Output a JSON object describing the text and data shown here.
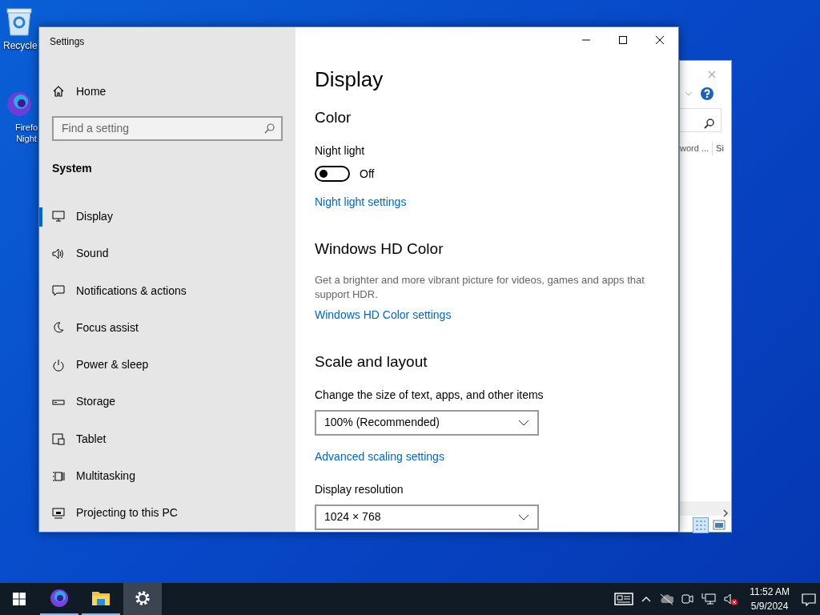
{
  "desktop": {
    "icons": [
      {
        "label": "Recycle"
      },
      {
        "label": "Firefo Night"
      }
    ]
  },
  "background_window": {
    "texts": [
      "word ...",
      "Si"
    ]
  },
  "window": {
    "title": "Settings",
    "sidebar": {
      "home": "Home",
      "search": {
        "placeholder": "Find a setting"
      },
      "section": "System",
      "items": [
        {
          "label": "Display",
          "selected": true
        },
        {
          "label": "Sound",
          "selected": false
        },
        {
          "label": "Notifications & actions",
          "selected": false
        },
        {
          "label": "Focus assist",
          "selected": false
        },
        {
          "label": "Power & sleep",
          "selected": false
        },
        {
          "label": "Storage",
          "selected": false
        },
        {
          "label": "Tablet",
          "selected": false
        },
        {
          "label": "Multitasking",
          "selected": false
        },
        {
          "label": "Projecting to this PC",
          "selected": false
        }
      ]
    },
    "content": {
      "title": "Display",
      "sections": [
        {
          "heading": "Color",
          "items": [
            {
              "kind": "label",
              "text": "Night light"
            },
            {
              "kind": "toggle",
              "on": false,
              "text": "Off"
            },
            {
              "kind": "link",
              "text": "Night light settings"
            }
          ]
        },
        {
          "heading": "Windows HD Color",
          "items": [
            {
              "kind": "description",
              "text": "Get a brighter and more vibrant picture for videos, games and apps that support HDR."
            },
            {
              "kind": "link",
              "text": "Windows HD Color settings"
            }
          ]
        },
        {
          "heading": "Scale and layout",
          "items": [
            {
              "kind": "label",
              "text": "Change the size of text, apps, and other items"
            },
            {
              "kind": "dropdown",
              "text": "100% (Recommended)"
            },
            {
              "kind": "link",
              "text": "Advanced scaling settings"
            },
            {
              "kind": "label",
              "text": "Display resolution"
            },
            {
              "kind": "dropdown",
              "text": "1024 × 768"
            }
          ]
        }
      ]
    }
  },
  "taskbar": {
    "apps": [
      {
        "kind": "firefox",
        "selected": false
      },
      {
        "kind": "explorer",
        "selected": false
      },
      {
        "kind": "settings",
        "selected": true
      }
    ],
    "time": "11:52 AM",
    "date": "5/9/2024"
  }
}
